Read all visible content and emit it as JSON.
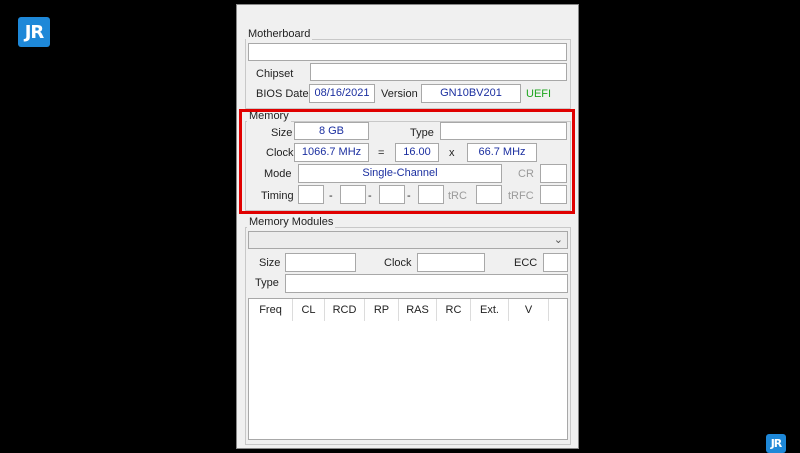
{
  "watermark": {
    "text": "JR",
    "color": "#1e88d8"
  },
  "motherboard": {
    "title": "Motherboard",
    "model_value": "",
    "chipset_label": "Chipset",
    "chipset_value": "",
    "bios_date_label": "BIOS Date",
    "bios_date_value": "08/16/2021",
    "version_label": "Version",
    "version_value": "GN10BV201",
    "uefi_label": "UEFI"
  },
  "memory": {
    "title": "Memory",
    "size_label": "Size",
    "size_value": "8 GB",
    "type_label": "Type",
    "type_value": "",
    "clock_label": "Clock",
    "clock_value": "1066.7 MHz",
    "equals": "=",
    "multiplier_value": "16.00",
    "times": "x",
    "bus_value": "66.7 MHz",
    "mode_label": "Mode",
    "mode_value": "Single-Channel",
    "cr_label": "CR",
    "timing_label": "Timing",
    "dash": "-",
    "trc_label": "tRC",
    "trfc_label": "tRFC",
    "highlight_color": "#e00000"
  },
  "modules": {
    "title": "Memory Modules",
    "selected_slot": "",
    "size_label": "Size",
    "clock_label": "Clock",
    "ecc_label": "ECC",
    "type_label": "Type",
    "columns": [
      "Freq",
      "CL",
      "RCD",
      "RP",
      "RAS",
      "RC",
      "Ext.",
      "V"
    ]
  }
}
